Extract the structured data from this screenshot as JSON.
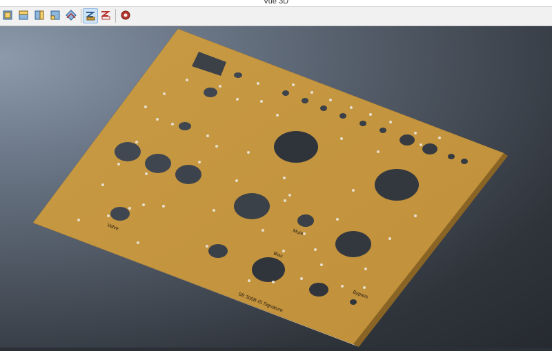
{
  "window": {
    "title": "Vue 3D"
  },
  "toolbar": {
    "buttons": [
      {
        "icon": "view-front-icon",
        "active": false
      },
      {
        "icon": "view-top-icon",
        "active": false
      },
      {
        "icon": "view-right-icon",
        "active": false
      },
      {
        "icon": "view-iso-icon",
        "active": false
      },
      {
        "icon": "view-eye-icon",
        "active": false
      },
      {
        "icon": "render-shaded-icon",
        "active": true
      },
      {
        "icon": "render-wire-icon",
        "active": false
      },
      {
        "icon": "settings-gear-icon",
        "active": false
      }
    ]
  },
  "panel": {
    "color": "#c8973f",
    "labels": {
      "valve": "Valve",
      "mute": "Mute",
      "bias": "Bias",
      "bypass": "Bypass",
      "signature": "SE 300B-IS Signature"
    }
  }
}
